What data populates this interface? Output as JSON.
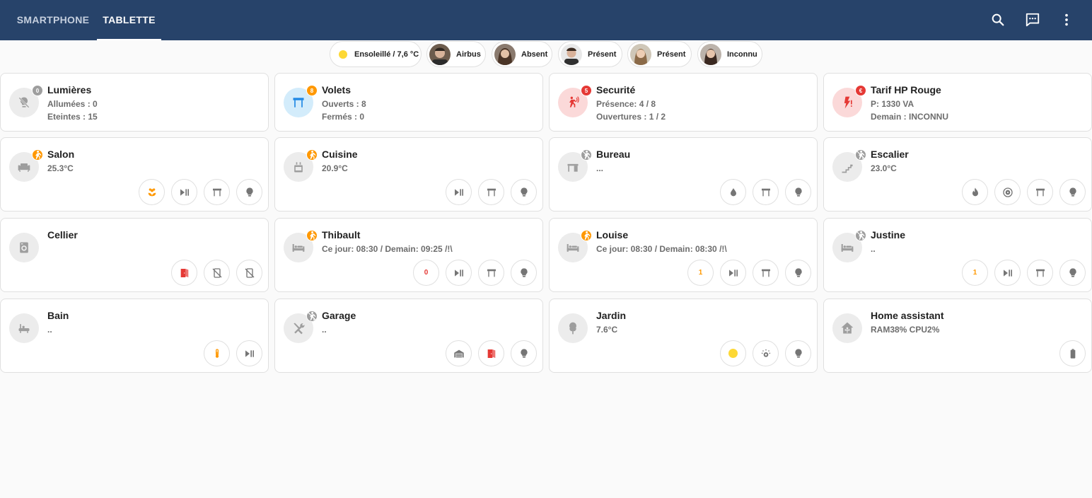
{
  "header": {
    "tabs": [
      {
        "label": "SMARTPHONE",
        "active": false
      },
      {
        "label": "TABLETTE",
        "active": true
      }
    ],
    "icons": [
      "search-icon",
      "chat-icon",
      "more-vert-icon"
    ]
  },
  "badges": [
    {
      "label": "Ensoleillé / 7,6 °C",
      "icon": "sun-icon"
    },
    {
      "label": "Airbus",
      "icon": "person-avatar"
    },
    {
      "label": "Absent",
      "icon": "person-avatar"
    },
    {
      "label": "Présent",
      "icon": "person-avatar"
    },
    {
      "label": "Présent",
      "icon": "person-avatar"
    },
    {
      "label": "Inconnu",
      "icon": "person-avatar"
    }
  ],
  "colors": {
    "header": "#27436a",
    "accent_orange": "#ff9800",
    "alert_red": "#e53935",
    "sun_yellow": "#fdd835"
  },
  "summary": [
    {
      "title": "Lumières",
      "line1": "Allumées : 0",
      "line2": "Eteintes : 15",
      "badge": "0"
    },
    {
      "title": "Volets",
      "line1": "Ouverts : 8",
      "line2": "Fermés : 0",
      "badge": "8"
    },
    {
      "title": "Securité",
      "line1": "Présence: 4 / 8",
      "line2": "Ouvertures : 1 / 2",
      "badge": "5"
    },
    {
      "title": "Tarif HP Rouge",
      "line1": "P: 1330 VA",
      "line2": "Demain : INCONNU",
      "badge": "€"
    }
  ],
  "rooms": [
    {
      "title": "Salon",
      "subtitle": "25.3°C",
      "icon": "sofa-icon",
      "badge": "motion-icon",
      "buttons": [
        "flower-icon",
        "play-pause-icon",
        "shutter-icon",
        "lightbulb-icon"
      ]
    },
    {
      "title": "Cuisine",
      "subtitle": "20.9°C",
      "icon": "stove-icon",
      "badge": "motion-icon",
      "buttons": [
        "play-pause-icon",
        "shutter-icon",
        "lightbulb-icon"
      ]
    },
    {
      "title": "Bureau",
      "subtitle": "...",
      "icon": "desk-icon",
      "badge": "motion-off-icon",
      "buttons": [
        "water-icon",
        "shutter-icon",
        "lightbulb-icon"
      ]
    },
    {
      "title": "Escalier",
      "subtitle": "23.0°C",
      "icon": "stairs-icon",
      "badge": "motion-off-icon",
      "buttons": [
        "fire-icon",
        "fan-icon",
        "shutter-icon",
        "lightbulb-icon"
      ]
    },
    {
      "title": "Cellier",
      "subtitle": "",
      "icon": "washing-machine-icon",
      "badge": "",
      "buttons": [
        "door-open-icon",
        "cellphone-off-icon",
        "cellphone-off-icon"
      ]
    },
    {
      "title": "Thibault",
      "subtitle": "Ce jour: 08:30 / Demain: 09:25 /!\\",
      "icon": "bed-icon",
      "badge": "motion-icon",
      "buttons": [
        "0",
        "play-pause-icon",
        "shutter-icon",
        "lightbulb-icon"
      ]
    },
    {
      "title": "Louise",
      "subtitle": "Ce jour: 08:30 / Demain: 08:30 /!\\",
      "icon": "bed-icon",
      "badge": "motion-icon",
      "buttons": [
        "1",
        "play-pause-icon",
        "shutter-icon",
        "lightbulb-icon"
      ]
    },
    {
      "title": "Justine",
      "subtitle": "..",
      "icon": "bed-icon",
      "badge": "motion-off-icon",
      "buttons": [
        "1",
        "play-pause-icon",
        "shutter-icon",
        "lightbulb-icon"
      ]
    },
    {
      "title": "Bain",
      "subtitle": "..",
      "icon": "bathtub-icon",
      "badge": "",
      "buttons": [
        "thermometer-icon",
        "play-pause-icon"
      ]
    },
    {
      "title": "Garage",
      "subtitle": "..",
      "icon": "tools-icon",
      "badge": "motion-off-icon",
      "buttons": [
        "garage-icon",
        "door-open-icon",
        "lightbulb-icon"
      ]
    },
    {
      "title": "Jardin",
      "subtitle": "7.6°C",
      "icon": "tree-icon",
      "badge": "",
      "buttons": [
        "sun-icon",
        "sprinkler-icon",
        "lightbulb-icon"
      ]
    },
    {
      "title": "Home assistant",
      "subtitle": "RAM38% CPU2%",
      "icon": "home-assistant-icon",
      "badge": "",
      "buttons": [
        "battery-icon"
      ]
    }
  ]
}
